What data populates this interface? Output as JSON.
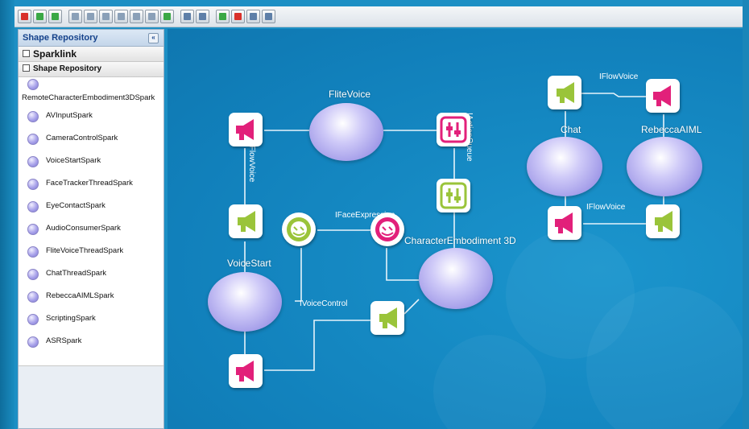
{
  "colors": {
    "canvas": "#1483bd",
    "output_port": "#e2207a",
    "input_port": "#9ac43a",
    "node_fill": "#a39df0",
    "sidebar_title": "#15428b"
  },
  "toolbar": {
    "buttons": [
      "delete-icon",
      "undo-icon",
      "redo-icon",
      "align-left-icon",
      "align-center-icon",
      "align-right-icon",
      "align-top-icon",
      "align-middle-icon",
      "align-bottom-icon",
      "zoom-fit-icon",
      "zoom-actual-icon",
      "export-icon",
      "import-icon",
      "group-icon",
      "ungroup-icon"
    ]
  },
  "sidebar": {
    "title": "Shape Repository",
    "collapse_symbol": "«",
    "group_sparklink": "Sparklink",
    "group_repository": "Shape Repository",
    "items": [
      "RemoteCharacterEmbodiment3DSpark",
      "AVInputSpark",
      "CameraControlSpark",
      "VoiceStartSpark",
      "FaceTrackerThreadSpark",
      "EyeContactSpark",
      "AudioConsumerSpark",
      "FliteVoiceThreadSpark",
      "ChatThreadSpark",
      "RebeccaAIMLSpark",
      "ScriptingSpark",
      "ASRSpark"
    ]
  },
  "diagram": {
    "nodes": {
      "flitevoice": "FliteVoice",
      "voicestart": "VoiceStart",
      "character": "CharacterEmbodiment 3D",
      "chat": "Chat",
      "rebecca": "RebeccaAIML"
    },
    "edges": {
      "iflowvoice_vertical": "IFlowVoice",
      "iactionqueue": "IActionQueue",
      "ifaceexpression": "IFaceExpression",
      "ivoicecontrol": "IVoiceControl",
      "iflowvoice_top": "IFlowVoice",
      "iflowvoice_bottom": "IFlowVoice"
    },
    "port_types": {
      "output": "megaphone-icon",
      "input": "megaphone-icon",
      "queue": "sliders-icon",
      "face": "smiley-icon"
    }
  }
}
